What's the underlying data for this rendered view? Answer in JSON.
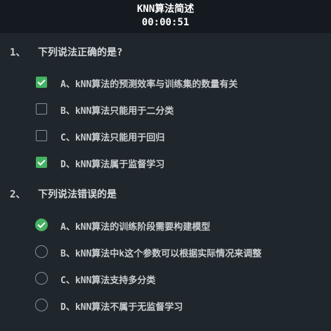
{
  "header": {
    "title": "KNN算法简述",
    "timer": "00:00:51"
  },
  "colors": {
    "background": "#1f262c",
    "header_background": "#141a1f",
    "checked": "#45b163",
    "unchecked_border": "#8a9196"
  },
  "questions": [
    {
      "number": "1、",
      "text": "下列说法正确的是?",
      "type": "multiple-choice",
      "options": [
        {
          "label": "A、kNN算法的预测效率与训练集的数量有关",
          "checked": true
        },
        {
          "label": "B、kNN算法只能用于二分类",
          "checked": false
        },
        {
          "label": "C、kNN算法只能用于回归",
          "checked": false
        },
        {
          "label": "D、kNN算法属于监督学习",
          "checked": true
        }
      ]
    },
    {
      "number": "2、",
      "text": "下列说法错误的是",
      "type": "single-choice",
      "options": [
        {
          "label": "A、kNN算法的训练阶段需要构建模型",
          "checked": true
        },
        {
          "label": "B、kNN算法中k这个参数可以根据实际情况来调整",
          "checked": false
        },
        {
          "label": "C、kNN算法支持多分类",
          "checked": false
        },
        {
          "label": "D、kNN算法不属于无监督学习",
          "checked": false
        }
      ]
    }
  ]
}
